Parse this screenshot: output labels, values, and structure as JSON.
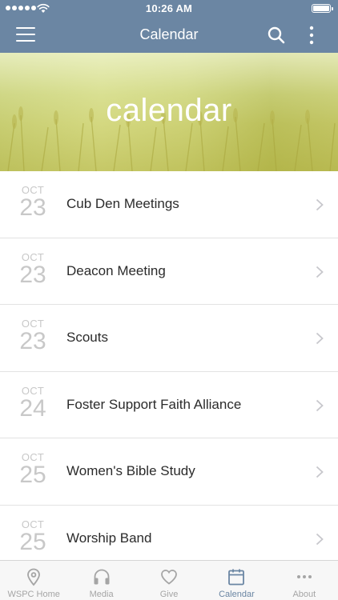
{
  "status_bar": {
    "time": "10:26 AM"
  },
  "nav": {
    "title": "Calendar"
  },
  "hero": {
    "title": "calendar"
  },
  "events": [
    {
      "month": "OCT",
      "day": "23",
      "title": "Cub Den Meetings"
    },
    {
      "month": "OCT",
      "day": "23",
      "title": "Deacon Meeting"
    },
    {
      "month": "OCT",
      "day": "23",
      "title": "Scouts"
    },
    {
      "month": "OCT",
      "day": "24",
      "title": "Foster Support Faith Alliance"
    },
    {
      "month": "OCT",
      "day": "25",
      "title": "Women's Bible Study"
    },
    {
      "month": "OCT",
      "day": "25",
      "title": "Worship Band"
    }
  ],
  "tabs": [
    {
      "label": "WSPC Home",
      "icon": "location-pin-icon",
      "active": false
    },
    {
      "label": "Media",
      "icon": "headphones-icon",
      "active": false
    },
    {
      "label": "Give",
      "icon": "heart-icon",
      "active": false
    },
    {
      "label": "Calendar",
      "icon": "calendar-icon",
      "active": true
    },
    {
      "label": "About",
      "icon": "ellipsis-icon",
      "active": false
    }
  ],
  "colors": {
    "nav_background": "#6b86a3",
    "active_tab": "#6b86a3",
    "inactive_tab": "#a5a5a5",
    "date_text": "#c8c8c8",
    "hero_tint": "#c9cf78"
  }
}
